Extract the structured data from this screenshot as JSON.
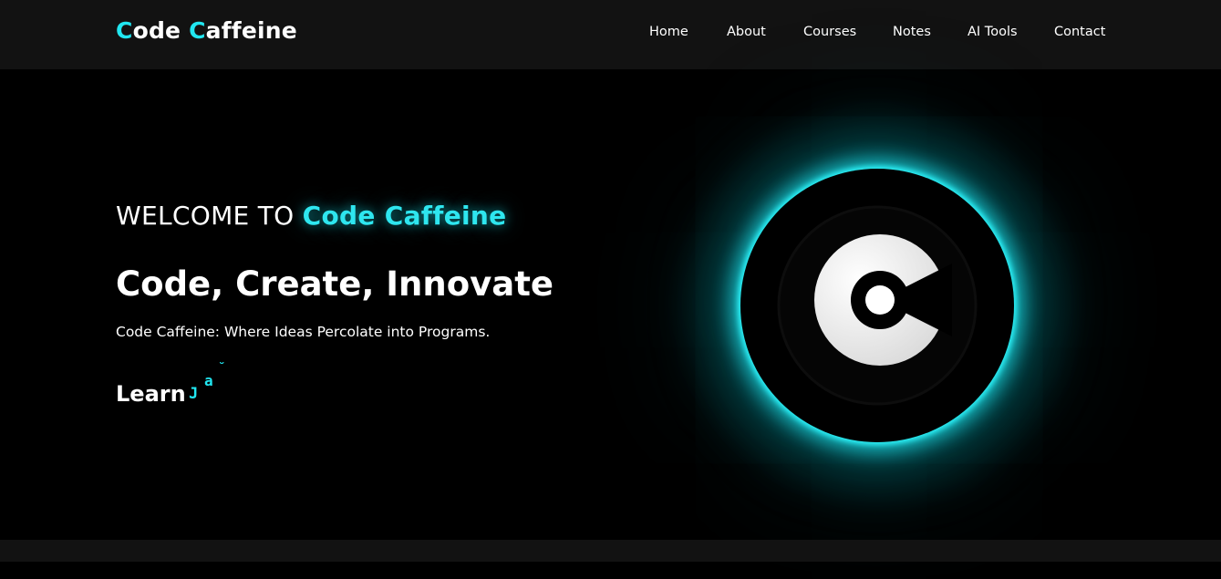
{
  "brand": {
    "first_initial": "C",
    "first_rest": "ode ",
    "second_initial": "C",
    "second_rest": "affeine"
  },
  "nav": {
    "items": [
      "Home",
      "About",
      "Courses",
      "Notes",
      "AI Tools",
      "Contact"
    ]
  },
  "hero": {
    "welcome_prefix": "WELCOME TO ",
    "welcome_brand": "Code Caffeine",
    "headline": "Code, Create, Innovate",
    "tagline": "Code Caffeine: Where Ideas Percolate into Programs.",
    "learn_label": "Learn",
    "typed_chars": [
      "J",
      "a",
      "˘"
    ]
  },
  "colors": {
    "accent": "#21e6f0",
    "navbar": "#121212",
    "background": "#000000"
  },
  "icons": {
    "logo": "code-caffeine-c-logo-icon"
  }
}
